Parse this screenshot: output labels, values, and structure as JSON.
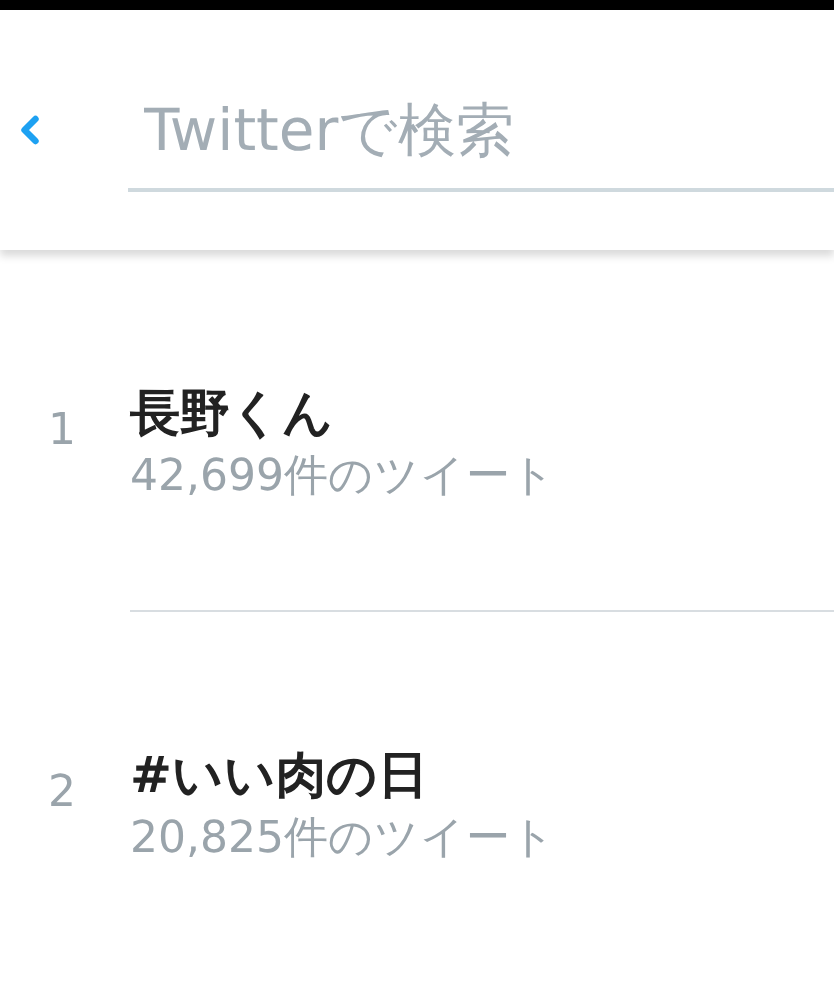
{
  "search": {
    "placeholder": "Twitterで検索"
  },
  "trends": [
    {
      "rank": "1",
      "title": "長野くん",
      "count": "42,699件のツイート"
    },
    {
      "rank": "2",
      "title": "#いい肉の日",
      "count": "20,825件のツイート"
    }
  ]
}
